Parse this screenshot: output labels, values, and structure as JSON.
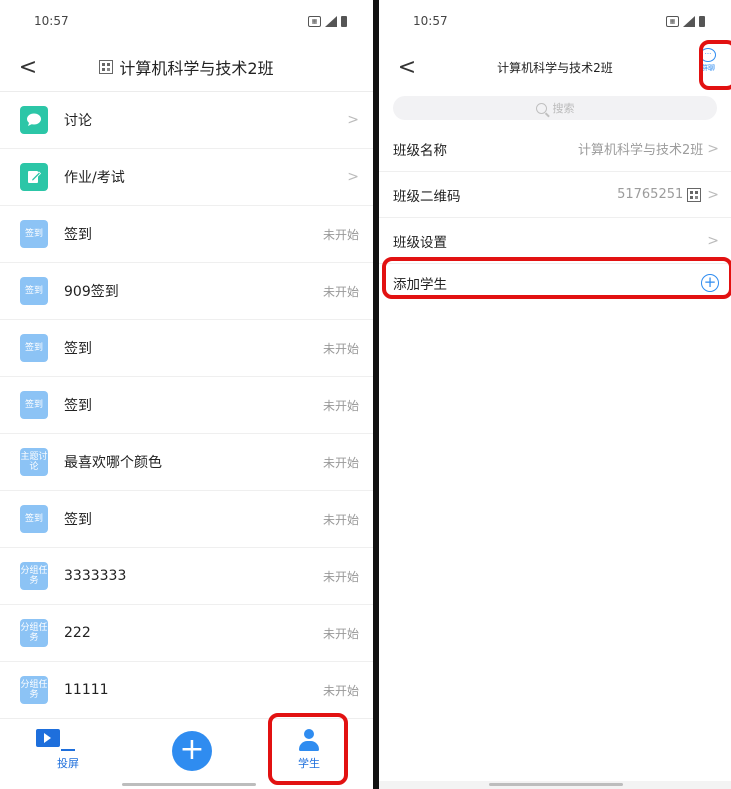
{
  "left": {
    "status": {
      "time": "10:57"
    },
    "nav": {
      "back": "<",
      "title": "计算机科学与技术2班"
    },
    "items": [
      {
        "icon_text": "",
        "icon": "chat-bubble-icon",
        "label": "讨论",
        "right": ">"
      },
      {
        "icon_text": "",
        "icon": "edit-icon",
        "label": "作业/考试",
        "right": ">"
      },
      {
        "icon_text": "签到",
        "label": "签到",
        "right": "未开始"
      },
      {
        "icon_text": "签到",
        "label": "909签到",
        "right": "未开始"
      },
      {
        "icon_text": "签到",
        "label": "签到",
        "right": "未开始"
      },
      {
        "icon_text": "签到",
        "label": "签到",
        "right": "未开始"
      },
      {
        "icon_text": "主题讨论",
        "label": "最喜欢哪个颜色",
        "right": "未开始"
      },
      {
        "icon_text": "签到",
        "label": "签到",
        "right": "未开始"
      },
      {
        "icon_text": "分组任务",
        "label": "3333333",
        "right": "未开始"
      },
      {
        "icon_text": "分组任务",
        "label": "222",
        "right": "未开始"
      },
      {
        "icon_text": "分组任务",
        "label": "11111",
        "right": "未开始"
      }
    ],
    "bottom_nav": {
      "screen": "投屏",
      "add": "+",
      "student": "学生"
    }
  },
  "right": {
    "status": {
      "time": "10:57"
    },
    "nav": {
      "back": "<",
      "title": "计算机科学与技术2班",
      "group_chat": "群聊"
    },
    "search": {
      "placeholder": "搜索"
    },
    "rows": [
      {
        "label": "班级名称",
        "value": "计算机科学与技术2班",
        "right": ">"
      },
      {
        "label": "班级二维码",
        "value": "51765251",
        "right": ">"
      },
      {
        "label": "班级设置",
        "value": "",
        "right": ">"
      },
      {
        "label": "添加学生",
        "value": "",
        "right": "+"
      }
    ]
  },
  "colors": {
    "accent": "#2f8cf0",
    "teal": "#2cc6a7",
    "light_blue": "#8cc3f5",
    "highlight": "#e21111"
  }
}
